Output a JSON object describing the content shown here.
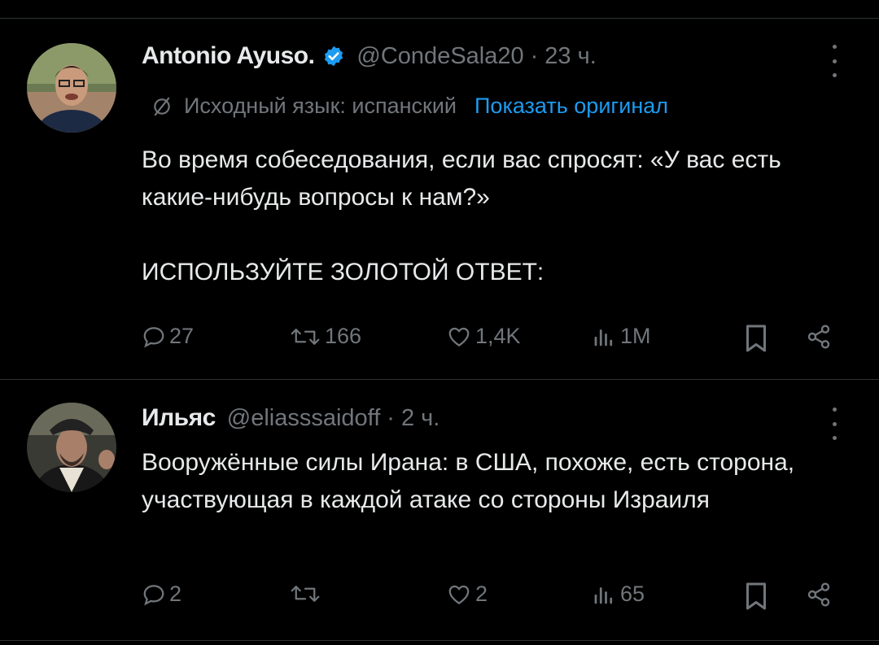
{
  "tweets": [
    {
      "author": {
        "name": "Antonio Ayuso.",
        "handle": "@CondeSala20",
        "verified": true
      },
      "time": "23 ч.",
      "separator": "·",
      "translation": {
        "label": "Исходный язык: испанский",
        "show_original": "Показать оригинал"
      },
      "paragraphs": [
        "Во время собеседования, если вас спросят: «У вас есть какие-нибудь вопросы к нам?»",
        "ИСПОЛЬЗУЙТЕ ЗОЛОТОЙ ОТВЕТ:"
      ],
      "stats": {
        "replies": "27",
        "reposts": "166",
        "likes": "1,4K",
        "views": "1M"
      }
    },
    {
      "author": {
        "name": "Ильяс",
        "handle": "@eliasssaidoff",
        "verified": false
      },
      "time": "2 ч.",
      "separator": "·",
      "paragraphs": [
        "Вооружённые силы Ирана: в США, похоже, есть сторона, участвующая в каждой атаке со стороны Израиля"
      ],
      "stats": {
        "replies": "2",
        "reposts": "",
        "likes": "2",
        "views": "65"
      }
    }
  ],
  "colors": {
    "background": "#000000",
    "text": "#e7e9ea",
    "muted": "#71767b",
    "link": "#1d9bf0",
    "divider": "#2f3336"
  }
}
